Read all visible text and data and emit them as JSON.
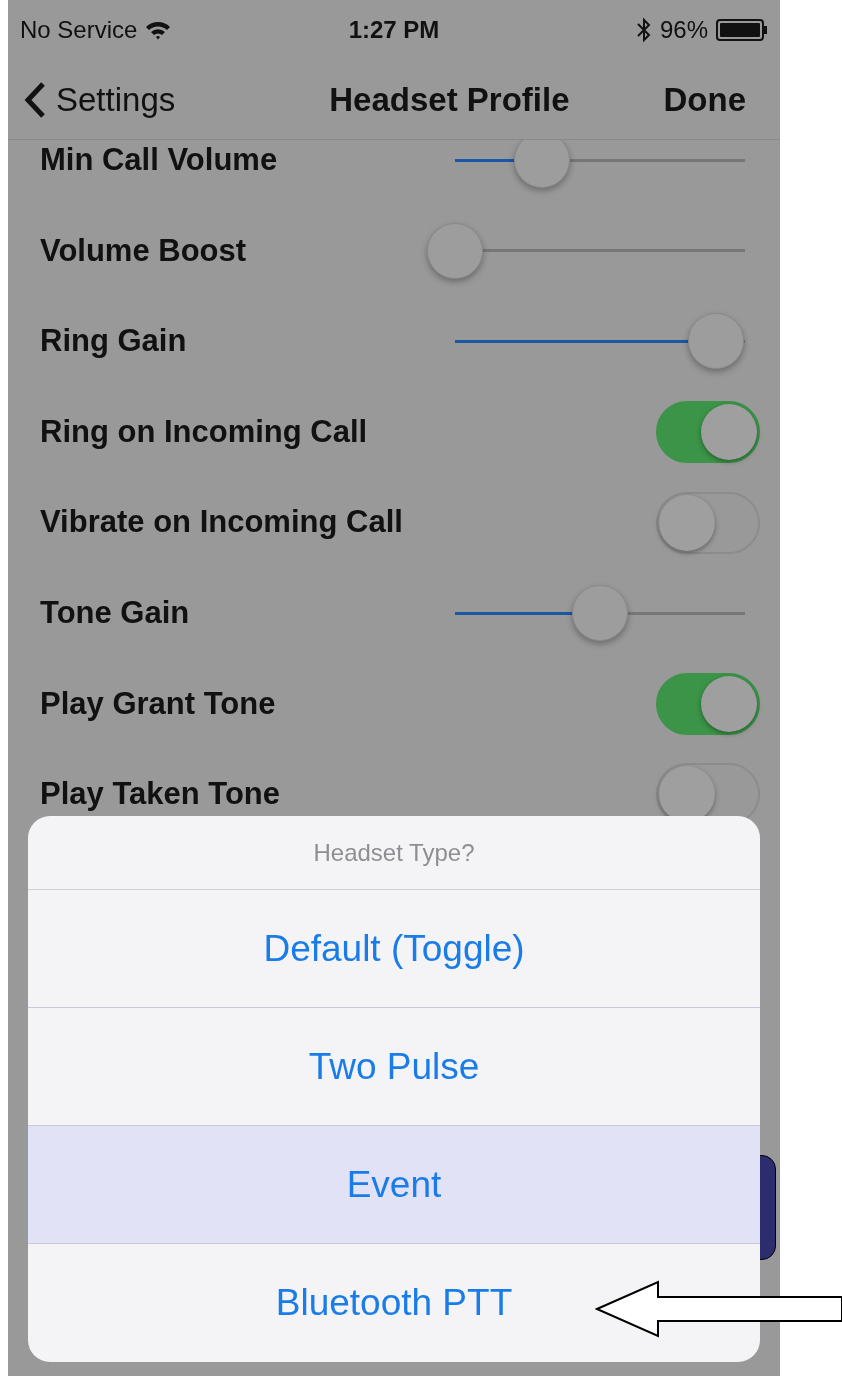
{
  "status_bar": {
    "carrier": "No Service",
    "time": "1:27 PM",
    "battery": "96%"
  },
  "nav_bar": {
    "back": "Settings",
    "title": "Headset Profile",
    "action": "Done"
  },
  "settings": [
    {
      "kind": "slider",
      "label": "Min Call Volume",
      "level": 0.3
    },
    {
      "kind": "slider",
      "label": "Volume Boost",
      "level": 0
    },
    {
      "kind": "slider",
      "label": "Ring Gain",
      "level": 0.9
    },
    {
      "kind": "toggle",
      "label": "Ring on Incoming Call",
      "on": true
    },
    {
      "kind": "toggle",
      "label": "Vibrate on Incoming Call",
      "on": false
    },
    {
      "kind": "slider",
      "label": "Tone Gain",
      "level": 0.5
    },
    {
      "kind": "toggle",
      "label": "Play Grant Tone",
      "on": true
    },
    {
      "kind": "toggle",
      "label": "Play Taken Tone",
      "on": false
    }
  ],
  "action_sheet": {
    "title": "Headset Type?",
    "options": [
      "Default (Toggle)",
      "Two Pulse",
      "Event",
      "Bluetooth PTT"
    ]
  }
}
